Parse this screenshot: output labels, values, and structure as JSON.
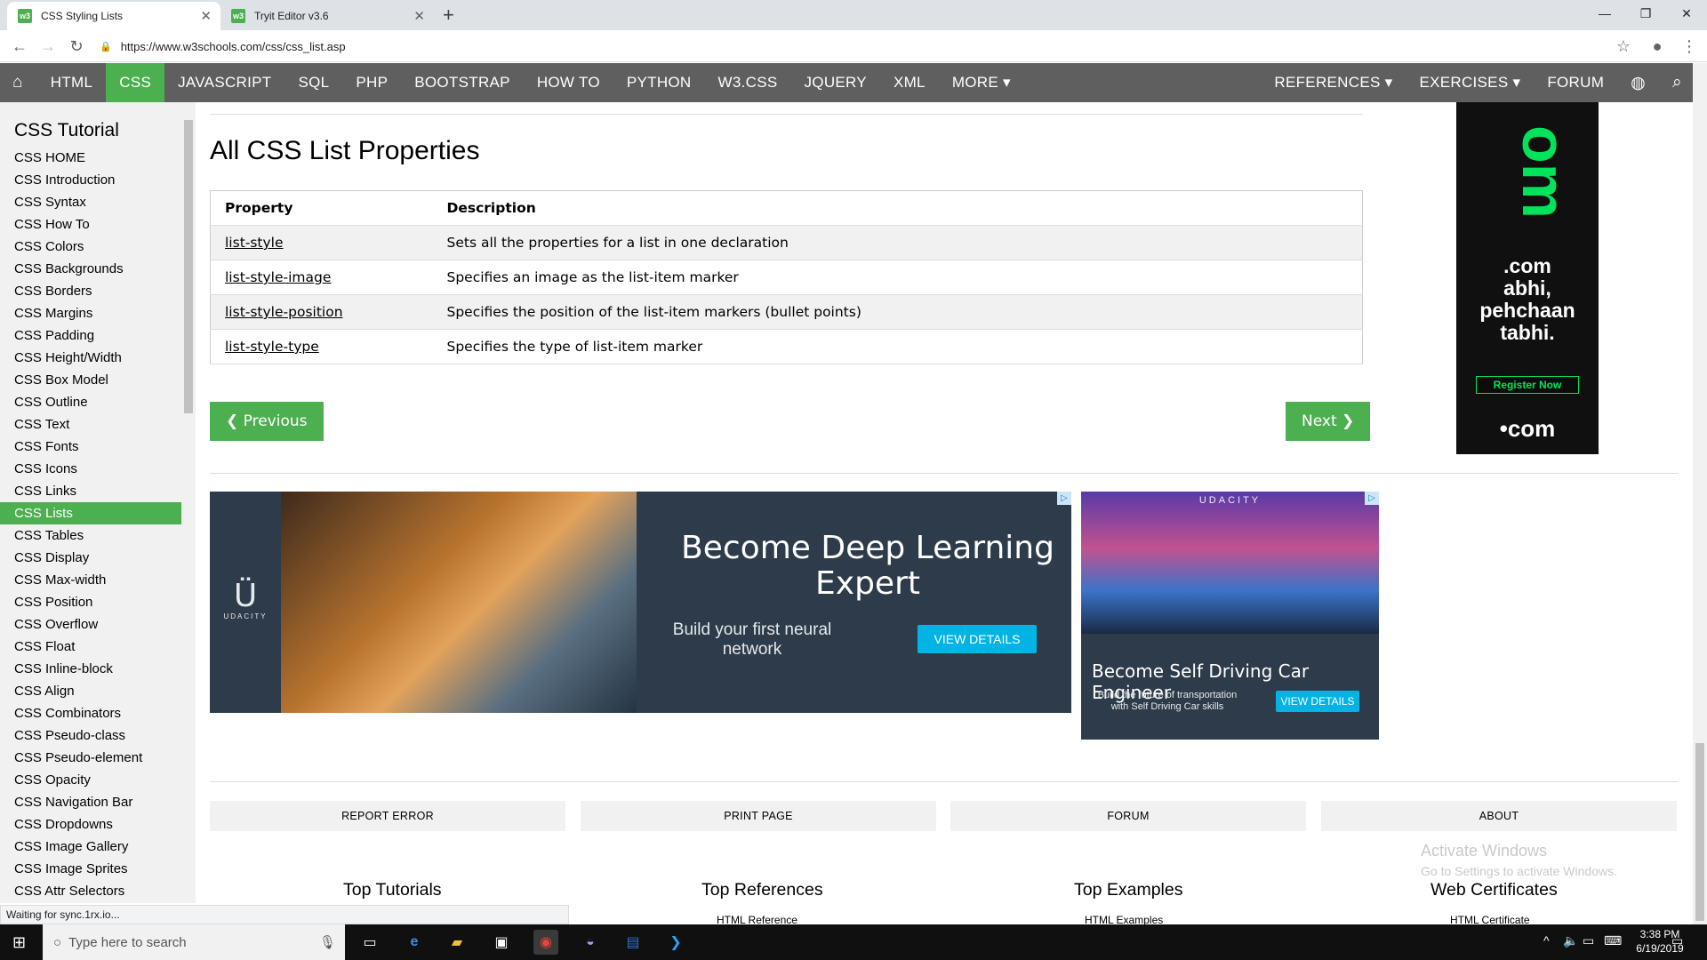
{
  "browser": {
    "tabs": [
      {
        "title": "CSS Styling Lists",
        "favicon": "w3",
        "active": true
      },
      {
        "title": "Tryit Editor v3.6",
        "favicon": "w3",
        "active": false
      }
    ],
    "url": "https://www.w3schools.com/css/css_list.asp",
    "status": "Waiting for sync.1rx.io..."
  },
  "topnav": {
    "home_icon": "home-icon",
    "items": [
      "HTML",
      "CSS",
      "JAVASCRIPT",
      "SQL",
      "PHP",
      "BOOTSTRAP",
      "HOW TO",
      "PYTHON",
      "W3.CSS",
      "JQUERY",
      "XML",
      "MORE ▾"
    ],
    "active": "CSS",
    "right_items": [
      "REFERENCES ▾",
      "EXERCISES ▾",
      "FORUM"
    ]
  },
  "sidebar": {
    "title": "CSS Tutorial",
    "items": [
      "CSS HOME",
      "CSS Introduction",
      "CSS Syntax",
      "CSS How To",
      "CSS Colors",
      "CSS Backgrounds",
      "CSS Borders",
      "CSS Margins",
      "CSS Padding",
      "CSS Height/Width",
      "CSS Box Model",
      "CSS Outline",
      "CSS Text",
      "CSS Fonts",
      "CSS Icons",
      "CSS Links",
      "CSS Lists",
      "CSS Tables",
      "CSS Display",
      "CSS Max-width",
      "CSS Position",
      "CSS Overflow",
      "CSS Float",
      "CSS Inline-block",
      "CSS Align",
      "CSS Combinators",
      "CSS Pseudo-class",
      "CSS Pseudo-element",
      "CSS Opacity",
      "CSS Navigation Bar",
      "CSS Dropdowns",
      "CSS Image Gallery",
      "CSS Image Sprites",
      "CSS Attr Selectors"
    ],
    "active": "CSS Lists"
  },
  "main": {
    "title": "All CSS List Properties",
    "table": {
      "headers": [
        "Property",
        "Description"
      ],
      "rows": [
        [
          "list-style",
          "Sets all the properties for a list in one declaration"
        ],
        [
          "list-style-image",
          "Specifies an image as the list-item marker"
        ],
        [
          "list-style-position",
          "Specifies the position of the list-item markers (bullet points)"
        ],
        [
          "list-style-type",
          "Specifies the type of list-item marker"
        ]
      ]
    },
    "prev_label": "❮ Previous",
    "next_label": "Next ❯"
  },
  "ads": {
    "udacity_dl": {
      "brand": "UDACITY",
      "headline": "Become Deep Learning Expert",
      "sub": "Build your first neural network",
      "cta": "VIEW DETAILS"
    },
    "udacity_car": {
      "brand": "UDACITY",
      "headline": "Become Self Driving Car Engineer",
      "sub": "Build the future of transportation with Self Driving Car skills",
      "cta": "VIEW DETAILS"
    },
    "dotcom": {
      "big": "om",
      "line1": ".com",
      "line2": "abhi,",
      "line3": "pehchaan",
      "line4": "tabhi.",
      "cta": "Register Now",
      "logo": "•com"
    }
  },
  "footer": {
    "buttons": [
      "REPORT ERROR",
      "PRINT PAGE",
      "FORUM",
      "ABOUT"
    ],
    "columns": [
      {
        "title": "Top Tutorials",
        "first": ""
      },
      {
        "title": "Top References",
        "first": "HTML Reference"
      },
      {
        "title": "Top Examples",
        "first": "HTML Examples"
      },
      {
        "title": "Web Certificates",
        "first": "HTML Certificate"
      }
    ]
  },
  "watermark": {
    "line1": "Activate Windows",
    "line2": "Go to Settings to activate Windows."
  },
  "taskbar": {
    "search_placeholder": "Type here to search",
    "time": "3:38 PM",
    "date": "6/19/2019"
  }
}
